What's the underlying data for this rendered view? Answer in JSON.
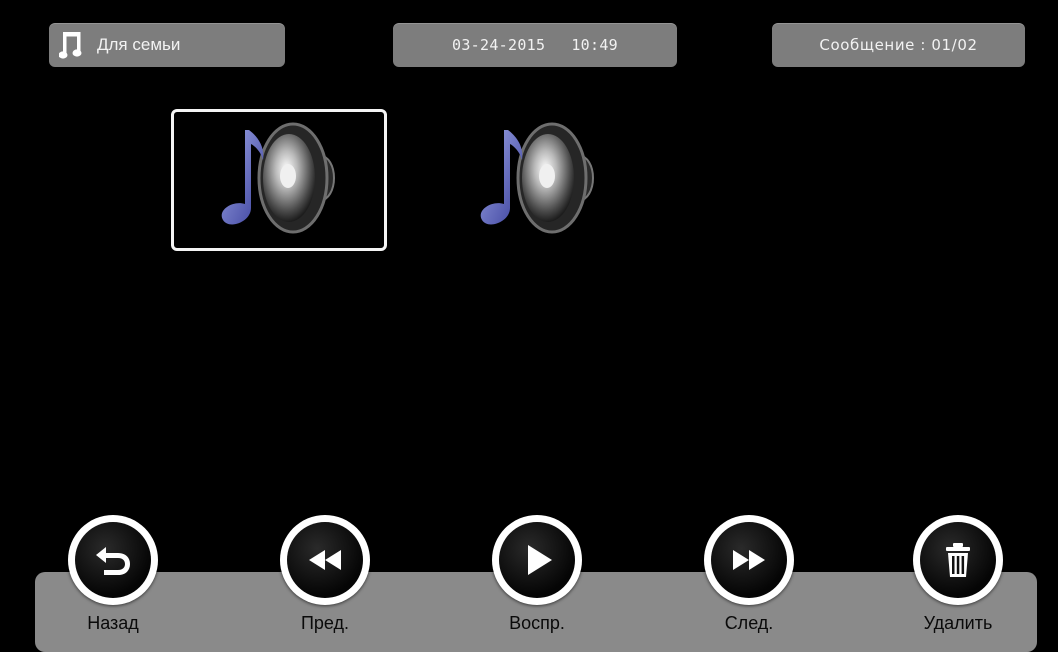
{
  "header": {
    "folder_icon": "music-note-icon",
    "folder_label": "Для семьи",
    "date": "03-24-2015",
    "time": "10:49",
    "message_counter": "Сообщение : 01/02"
  },
  "items": [
    {
      "icon": "speaker-music-icon",
      "selected": true
    },
    {
      "icon": "speaker-music-icon",
      "selected": false
    }
  ],
  "controls": {
    "back": {
      "label": "Назад",
      "icon": "back-arrow-icon"
    },
    "prev": {
      "label": "Пред.",
      "icon": "rewind-icon"
    },
    "play": {
      "label": "Воспр.",
      "icon": "play-icon"
    },
    "next": {
      "label": "След.",
      "icon": "fast-forward-icon"
    },
    "delete": {
      "label": "Удалить",
      "icon": "trash-icon"
    }
  },
  "colors": {
    "background": "#000000",
    "pill": "#7d7d7d",
    "toolbar": "#8a8a8a",
    "selection_border": "#f4f4f4"
  }
}
